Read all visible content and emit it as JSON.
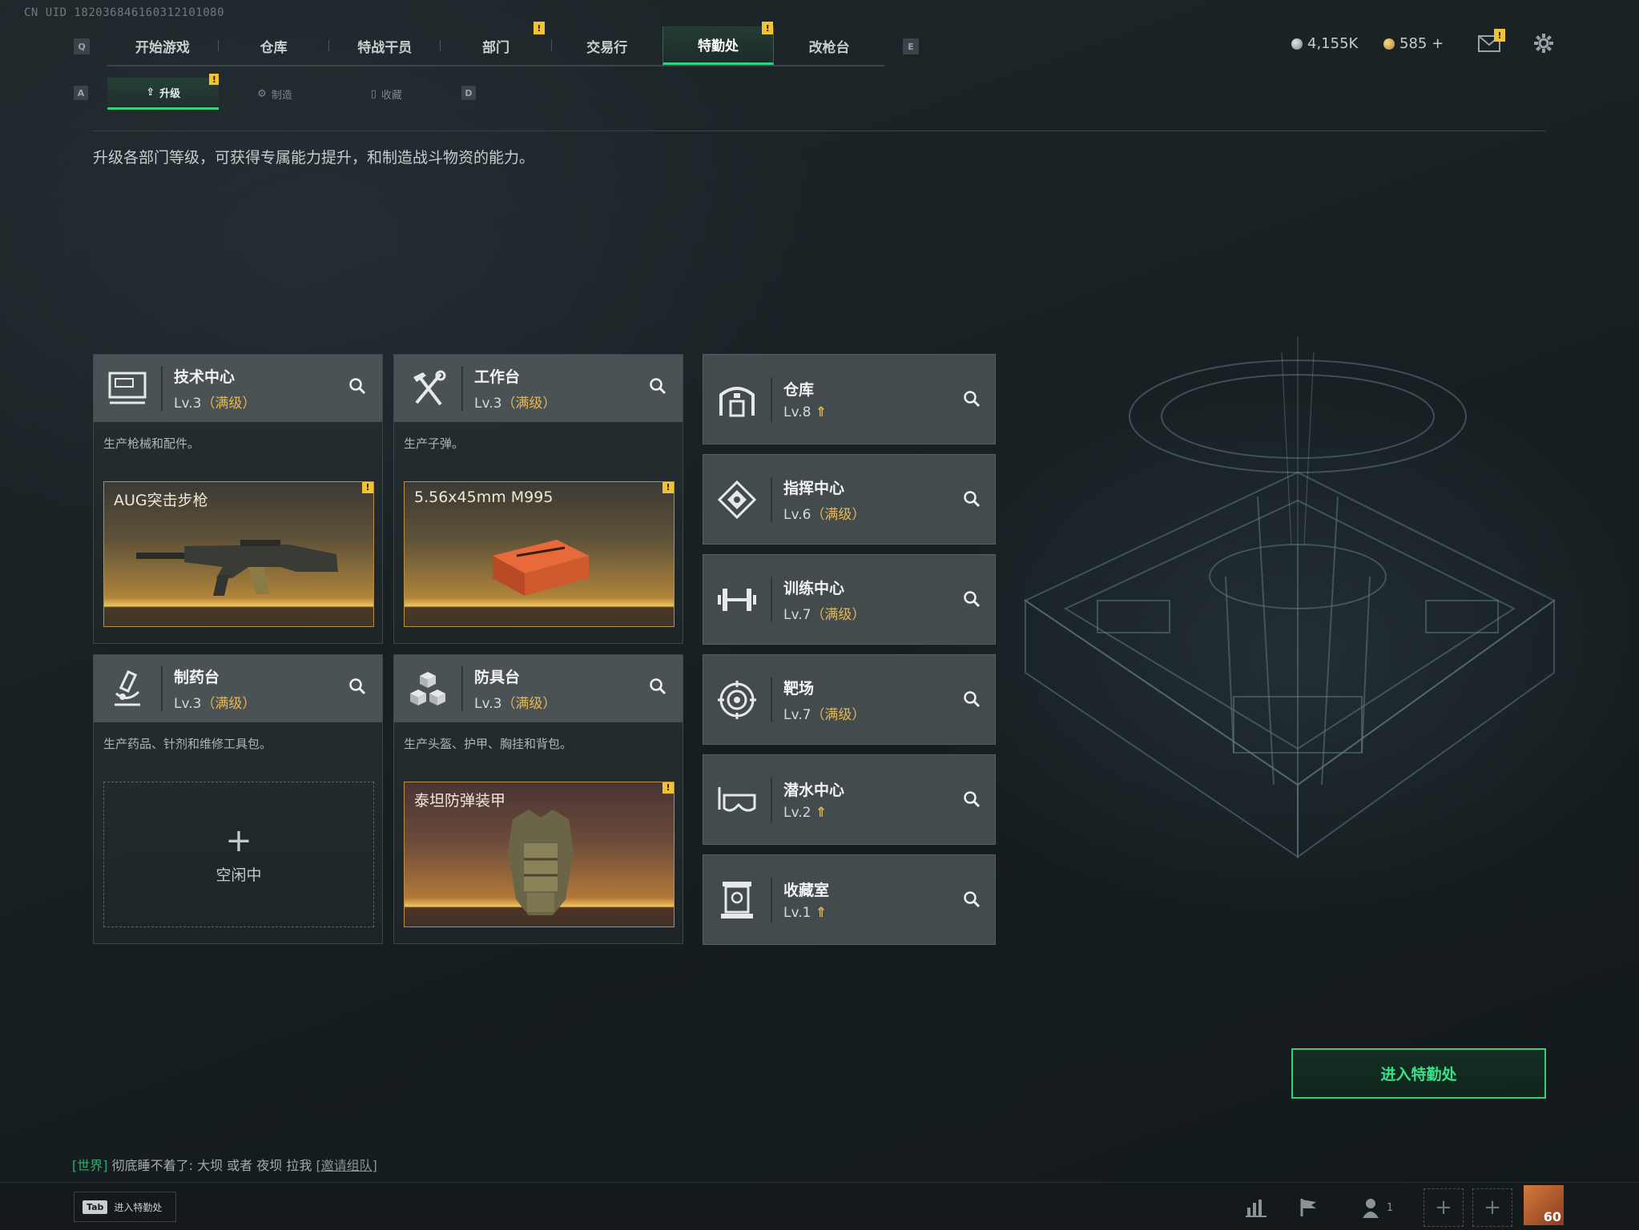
{
  "uid": "CN UID 182036846160312101080",
  "nav": {
    "left_key": "Q",
    "right_key": "E",
    "tabs": [
      {
        "label": "开始游戏"
      },
      {
        "label": "仓库"
      },
      {
        "label": "特战干员"
      },
      {
        "label": "部门"
      },
      {
        "label": "交易行"
      },
      {
        "label": "特勤处"
      },
      {
        "label": "改枪台"
      }
    ],
    "active_tab": "特勤处"
  },
  "currency": {
    "primary": "4,155K",
    "secondary": "585 +"
  },
  "subnav": {
    "left_key": "A",
    "right_key": "D",
    "tabs": [
      {
        "label": "升级"
      },
      {
        "label": "制造"
      },
      {
        "label": "收藏"
      }
    ]
  },
  "description": "升级各部门等级，可获得专属能力提升，和制造战斗物资的能力。",
  "stations": [
    {
      "name": "技术中心",
      "level": "Lv.3",
      "status": "（满级）",
      "desc": "生产枪械和配件。",
      "item": "AUG突击步枪"
    },
    {
      "name": "工作台",
      "level": "Lv.3",
      "status": "（满级）",
      "desc": "生产子弹。",
      "item": "5.56x45mm M995"
    },
    {
      "name": "制药台",
      "level": "Lv.3",
      "status": "（满级）",
      "desc": "生产药品、针剂和维修工具包。",
      "item": ""
    },
    {
      "name": "防具台",
      "level": "Lv.3",
      "status": "（满级）",
      "desc": "生产头盔、护甲、胸挂和背包。",
      "item": "泰坦防弹装甲"
    }
  ],
  "idle": {
    "label": "空闲中"
  },
  "facilities": [
    {
      "name": "仓库",
      "level": "Lv.8",
      "status": ""
    },
    {
      "name": "指挥中心",
      "level": "Lv.6",
      "status": "（满级）"
    },
    {
      "name": "训练中心",
      "level": "Lv.7",
      "status": "（满级）"
    },
    {
      "name": "靶场",
      "level": "Lv.7",
      "status": "（满级）"
    },
    {
      "name": "潜水中心",
      "level": "Lv.2",
      "status": ""
    },
    {
      "name": "收藏室",
      "level": "Lv.1",
      "status": ""
    }
  ],
  "enter_button": "进入特勤处",
  "chat": {
    "channel": "[世界]",
    "message": "彻底睡不着了: 大坝 或者 夜坝  拉我",
    "link": "[邀请组队]"
  },
  "bottom": {
    "tab_key": "Tab",
    "tab_label": "进入特勤处",
    "friends_count": "1",
    "avatar_level": "60"
  },
  "colors": {
    "accent_green": "#2fd47a",
    "max_gold": "#e9b84a",
    "alert_yellow": "#f1c232"
  }
}
